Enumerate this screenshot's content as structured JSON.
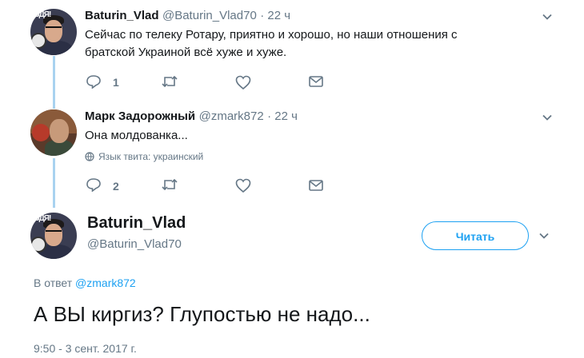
{
  "tweets": [
    {
      "name": "Baturin_Vlad",
      "handle": "@Baturin_Vlad70",
      "time": "· 22 ч",
      "text_line1": "Сейчас по телеку Ротару, приятно и хорошо, но наши отношения с",
      "text_line2": "братской Украиной всё хуже и хуже.",
      "reply_count": "1"
    },
    {
      "name": "Марк Задорожный",
      "handle": "@zmark872",
      "time": "· 22 ч",
      "text_line1": "Она молдованка...",
      "lang_note": "Язык твита: украинский",
      "reply_count": "2"
    }
  ],
  "main_tweet": {
    "name": "Baturin_Vlad",
    "handle": "@Baturin_Vlad70",
    "follow_label": "Читать",
    "reply_prefix": "В ответ",
    "reply_to": "@zmark872",
    "text": "А ВЫ киргиз? Глупостью не надо...",
    "timestamp": "9:50 - 3 сент. 2017 г."
  },
  "avatar_sign": "ОДЯ!",
  "colors": {
    "accent": "#1da1f2",
    "thread_line": "#a9d2f0",
    "secondary_text": "#657786"
  },
  "icons": [
    "chevron-down-icon",
    "reply-icon",
    "retweet-icon",
    "like-icon",
    "dm-icon",
    "globe-icon"
  ]
}
